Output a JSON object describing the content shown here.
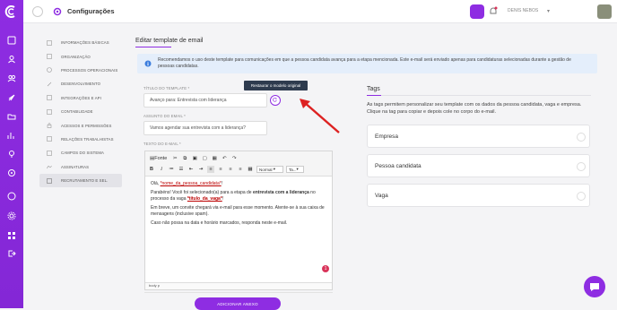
{
  "header": {
    "title": "Configurações",
    "user_name": "DENIS NEBOS"
  },
  "sidebar": {
    "items": [
      {
        "label": "INFORMAÇÕES BÁSICAS",
        "icon": "info-icon"
      },
      {
        "label": "ORGANIZAÇÃO",
        "icon": "org-icon"
      },
      {
        "label": "PROCESSOS OPERACIONAIS",
        "icon": "process-icon"
      },
      {
        "label": "DESENVOLVIMENTO",
        "icon": "dev-icon"
      },
      {
        "label": "INTEGRAÇÕES E API",
        "icon": "api-icon"
      },
      {
        "label": "CONTABILIDADE",
        "icon": "accounting-icon"
      },
      {
        "label": "ACESSOS E PERMISSÕES",
        "icon": "lock-icon"
      },
      {
        "label": "RELAÇÕES TRABALHISTAS",
        "icon": "labor-icon"
      },
      {
        "label": "CAMPOS DO SISTEMA",
        "icon": "fields-icon"
      },
      {
        "label": "ASSINATURAS",
        "icon": "signature-icon"
      },
      {
        "label": "RECRUTAMENTO E SEL.",
        "icon": "recruit-icon",
        "active": true
      }
    ]
  },
  "main": {
    "heading": "Editar template de email",
    "alert": "Recomendamos o uso deste template para comunicações em que a pessoa candidata avança para a etapa mencionada. Este e-mail será enviado apenas para candidaturas selecionadas durante a gestão de pessoas candidatas.",
    "template_title_label": "TÍTULO DO TEMPLATE *",
    "template_title_value": "Avanço para: Entrevista com liderança",
    "tooltip": "Restaurar o modelo original",
    "subject_label": "ASSUNTO DO EMAIL *",
    "subject_value": "Vamos agendar sua entrevista com a liderança?",
    "body_label": "TEXTO DO E-MAIL *",
    "toolbar": {
      "source": "Fonte",
      "format": "Normal",
      "size": "Ta..."
    },
    "editor": {
      "greeting_prefix": "Olá, ",
      "greeting_tag": "*nome_da_pessoa_candidata*",
      "greeting_suffix": "!",
      "p2_a": "Parabéns! Você foi selecionado(a) para a etapa de ",
      "p2_b": "entrevista com a liderança",
      "p2_c": " no processo da vaga ",
      "p2_tag": "*titulo_da_vaga*",
      "p2_d": "!",
      "p3": "Em breve, um convite chegará via e-mail para esse momento. Atente-se à sua caixa de mensagens (inclusive spam).",
      "p4": "Caso não possa na data e horário marcados, responda neste e-mail.",
      "status": "body  p",
      "badge": "1"
    },
    "attach_button": "ADICIONAR ANEXO"
  },
  "tags": {
    "title": "Tags",
    "description": "As tags permitem personalizar seu template com os dados da pessoa candidata, vaga e empresa. Clique na tag para copiar e depois cole no corpo do e-mail.",
    "groups": [
      "Empresa",
      "Pessoa candidata",
      "Vaga"
    ]
  },
  "colors": {
    "brand": "#8e2de2",
    "alert_bg": "#e4eefb",
    "tooltip_bg": "#2e3b4e",
    "arrow": "#d22"
  }
}
